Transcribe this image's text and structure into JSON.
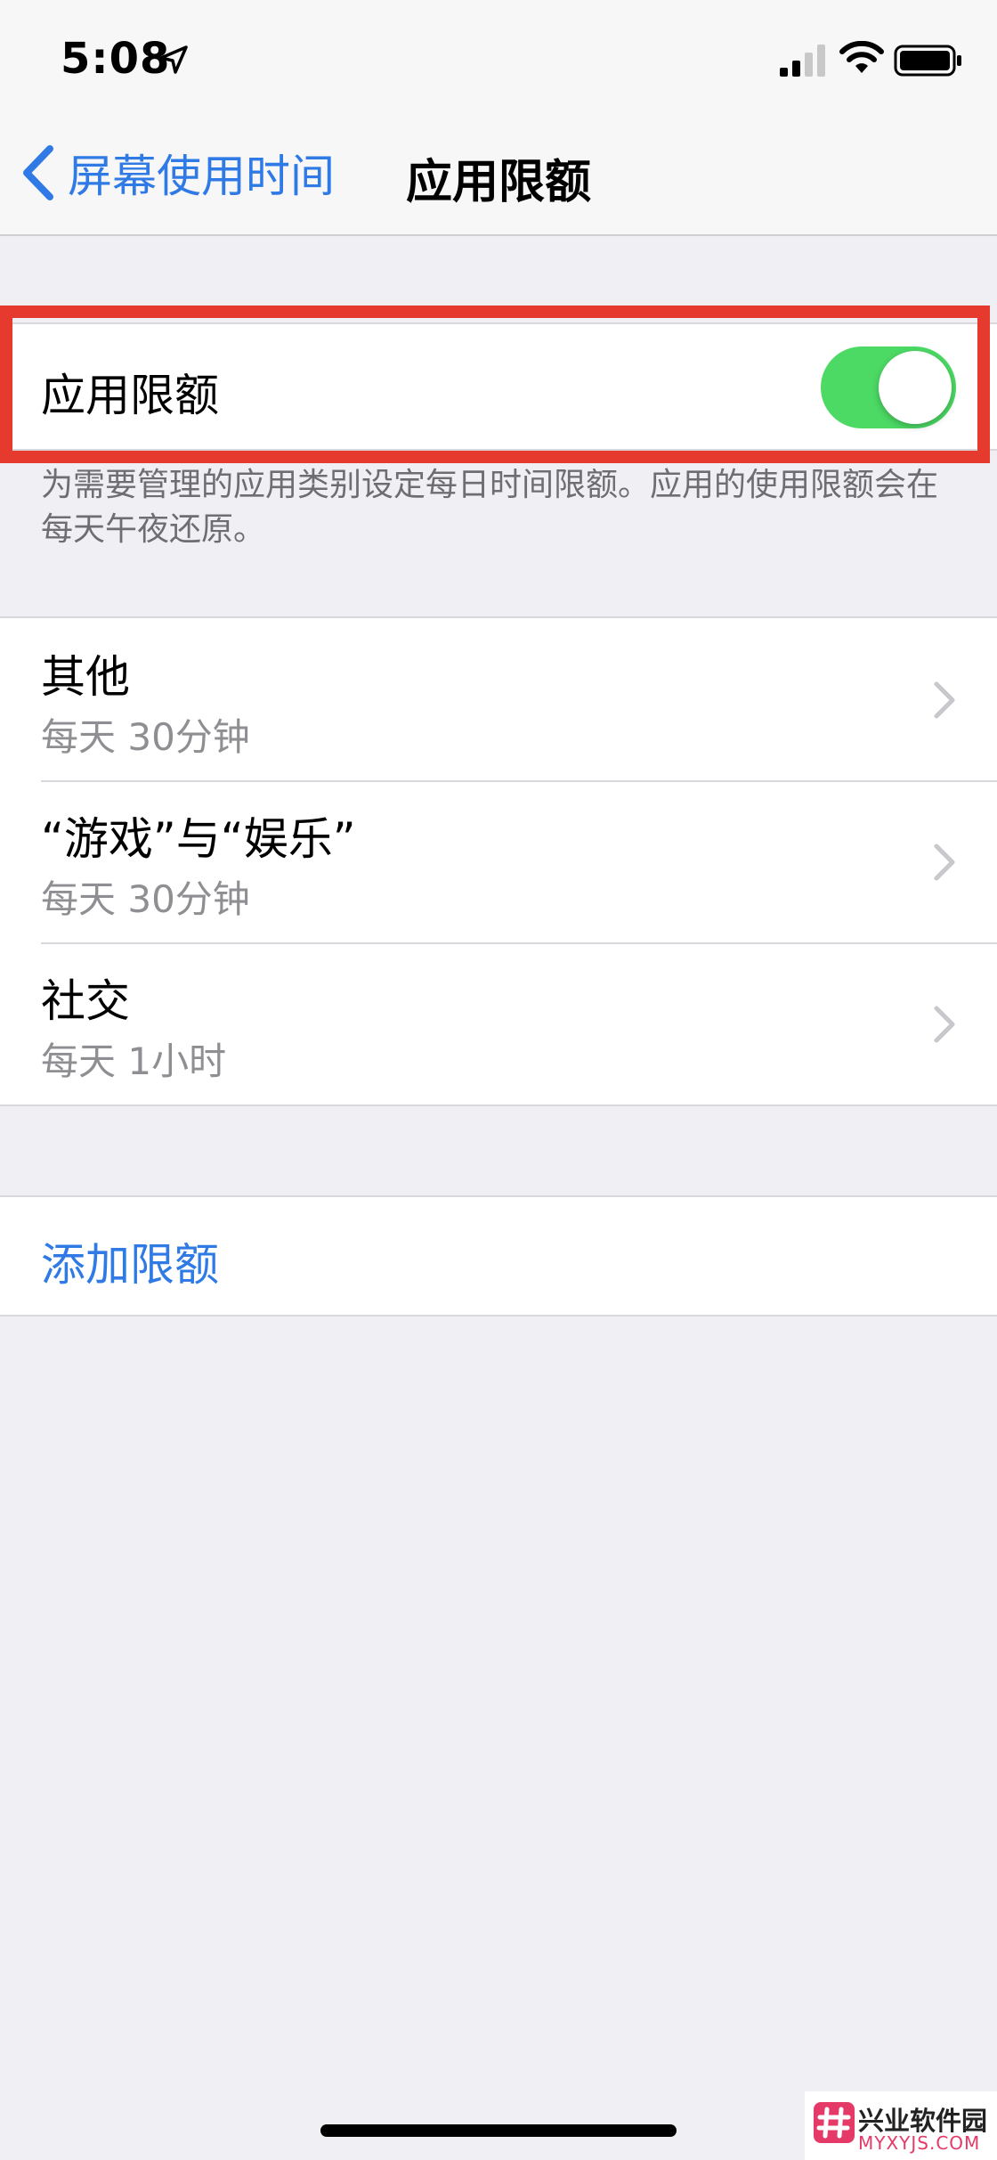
{
  "status_bar": {
    "time": "5:08",
    "icons": [
      "location-icon",
      "signal-icon",
      "wifi-icon",
      "battery-icon"
    ]
  },
  "nav": {
    "back_label": "屏幕使用时间",
    "title": "应用限额"
  },
  "toggle": {
    "label": "应用限额",
    "state": "on"
  },
  "footer_note": "为需要管理的应用类别设定每日时间限额。应用的使用限额会在每天午夜还原。",
  "categories": [
    {
      "title": "其他",
      "subtitle": "每天 30分钟"
    },
    {
      "title": "“游戏”与“娱乐”",
      "subtitle": "每天 30分钟"
    },
    {
      "title": "社交",
      "subtitle": "每天 1小时"
    }
  ],
  "add_limit_label": "添加限额",
  "watermark": {
    "name": "兴业软件园",
    "url": "MYXYJS.COM"
  },
  "colors": {
    "accent": "#2f7ae5",
    "toggle_on": "#4cd964",
    "highlight": "#e53a2d",
    "background": "#efeff4"
  }
}
